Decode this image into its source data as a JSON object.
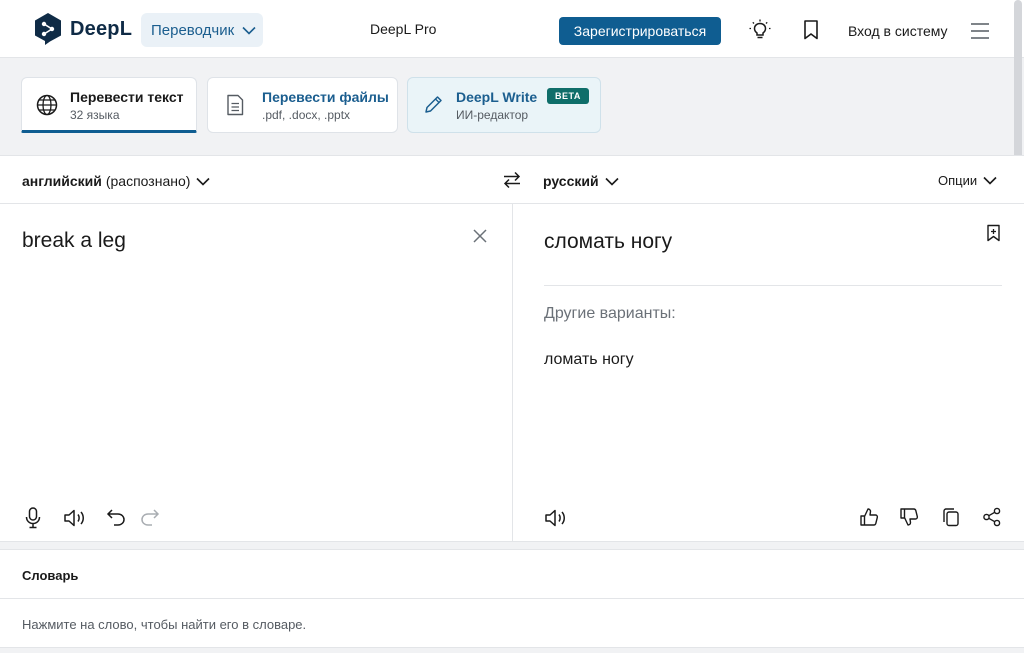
{
  "header": {
    "logo_text": "DeepL",
    "translator_label": "Переводчик",
    "pro_label": "DeepL Pro",
    "signup_label": "Зарегистрироваться",
    "login_label": "Вход в систему",
    "icons": [
      "lightbulb-icon",
      "bookmark-icon",
      "hamburger-menu-icon"
    ],
    "accent_color": "#0f5d91"
  },
  "tabs": [
    {
      "title": "Перевести текст",
      "subtitle": "32 языка",
      "icon": "globe-icon",
      "active": true
    },
    {
      "title": "Перевести файлы",
      "subtitle": ".pdf, .docx, .pptx",
      "icon": "document-icon",
      "active": false
    },
    {
      "title": "DeepL Write",
      "subtitle": "ИИ-редактор",
      "badge": "BETA",
      "icon": "pen-icon",
      "active": false
    }
  ],
  "source": {
    "language": "английский",
    "detected_note": "(распознано)",
    "text": "break a leg"
  },
  "target": {
    "language": "русский",
    "options_label": "Опции",
    "text": "сломать ногу",
    "alternatives_heading": "Другие варианты:",
    "alternatives": [
      "ломать ногу"
    ]
  },
  "dictionary": {
    "title": "Словарь",
    "hint": "Нажмите на слово, чтобы найти его в словаре."
  }
}
